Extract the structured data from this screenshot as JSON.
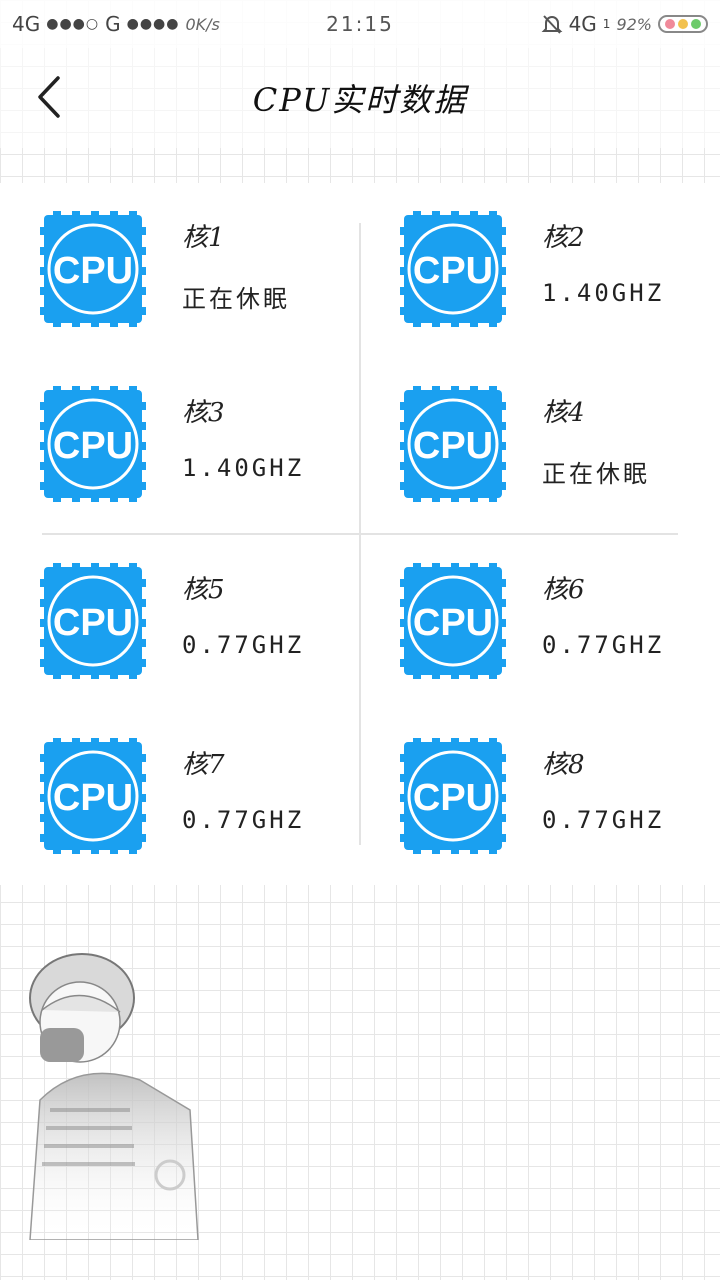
{
  "status_bar": {
    "network_left": "4G",
    "signal_left": "●●●○",
    "network_mid": "G",
    "signal_mid": "●●●●",
    "speed": "0K/s",
    "time": "21:15",
    "network_right": "4G",
    "sim": "1",
    "battery": "92%"
  },
  "header": {
    "title": "CPU实时数据"
  },
  "icon": {
    "label": "CPU",
    "color": "#1aa0f0"
  },
  "cores": [
    {
      "name": "核1",
      "value": "正在休眠"
    },
    {
      "name": "核2",
      "value": "1.40GHZ"
    },
    {
      "name": "核3",
      "value": "1.40GHZ"
    },
    {
      "name": "核4",
      "value": "正在休眠"
    },
    {
      "name": "核5",
      "value": "0.77GHZ"
    },
    {
      "name": "核6",
      "value": "0.77GHZ"
    },
    {
      "name": "核7",
      "value": "0.77GHZ"
    },
    {
      "name": "核8",
      "value": "0.77GHZ"
    }
  ]
}
